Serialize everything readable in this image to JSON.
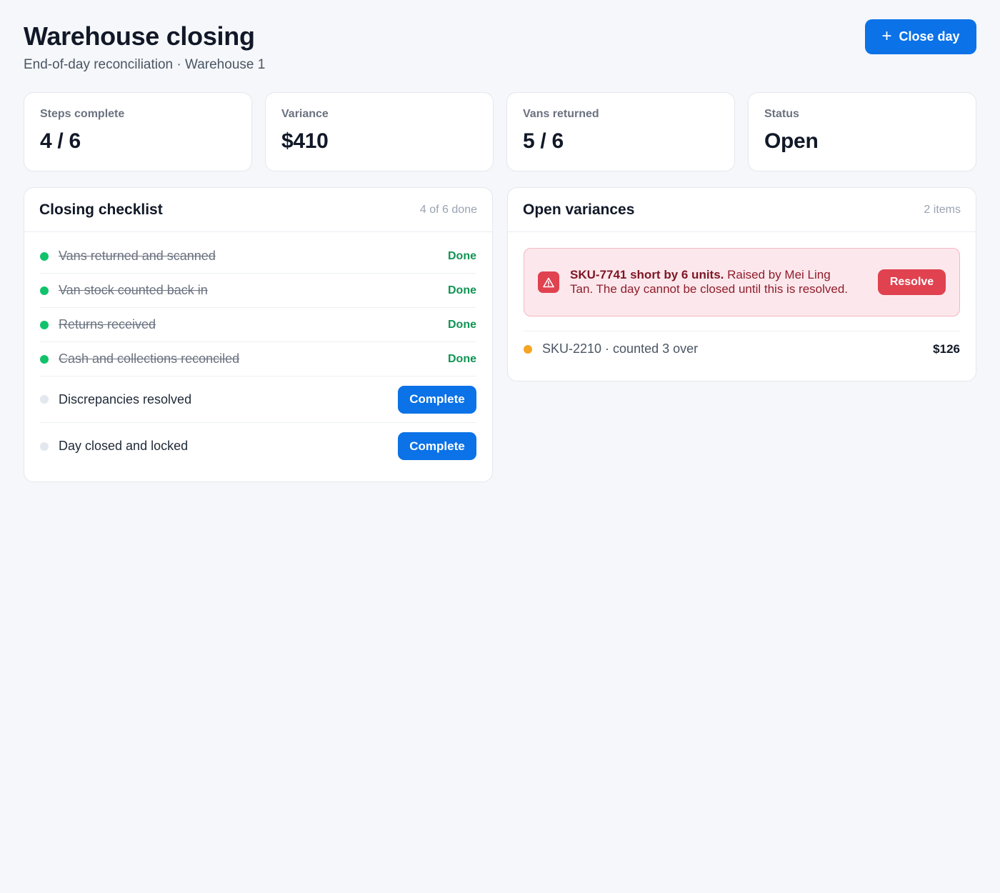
{
  "header": {
    "title": "Warehouse closing",
    "subtitle": "End-of-day reconciliation · Warehouse 1",
    "close_day_label": "Close day",
    "close_day_icon": "plus-icon"
  },
  "kpis": [
    {
      "label": "Steps complete",
      "value": "4 / 6"
    },
    {
      "label": "Variance",
      "value": "$410"
    },
    {
      "label": "Vans returned",
      "value": "5 / 6"
    },
    {
      "label": "Status",
      "value": "Open"
    }
  ],
  "checklist": {
    "title": "Closing checklist",
    "meta": "4 of 6 done",
    "items": [
      {
        "label": "Vans returned and scanned",
        "status": "Done"
      },
      {
        "label": "Van stock counted back in",
        "status": "Done"
      },
      {
        "label": "Returns received",
        "status": "Done"
      },
      {
        "label": "Cash and collections reconciled",
        "status": "Done"
      },
      {
        "label": "Discrepancies resolved",
        "action": "Complete"
      },
      {
        "label": "Day closed and locked",
        "action": "Complete"
      }
    ]
  },
  "variances": {
    "title": "Open variances",
    "meta": "2 items",
    "alert": {
      "icon": "warning-icon",
      "strong": "SKU-7741 short by 6 units.",
      "text": " Raised by Mei Ling Tan. The day cannot be closed until this is resolved.",
      "action": "Resolve"
    },
    "rows": [
      {
        "label": "SKU-2210 · counted 3 over",
        "amount": "$126"
      }
    ]
  },
  "colors": {
    "primary": "#0b72e7",
    "done_green": "#12c26b",
    "danger": "#e0424f",
    "warning": "#f5a524"
  }
}
